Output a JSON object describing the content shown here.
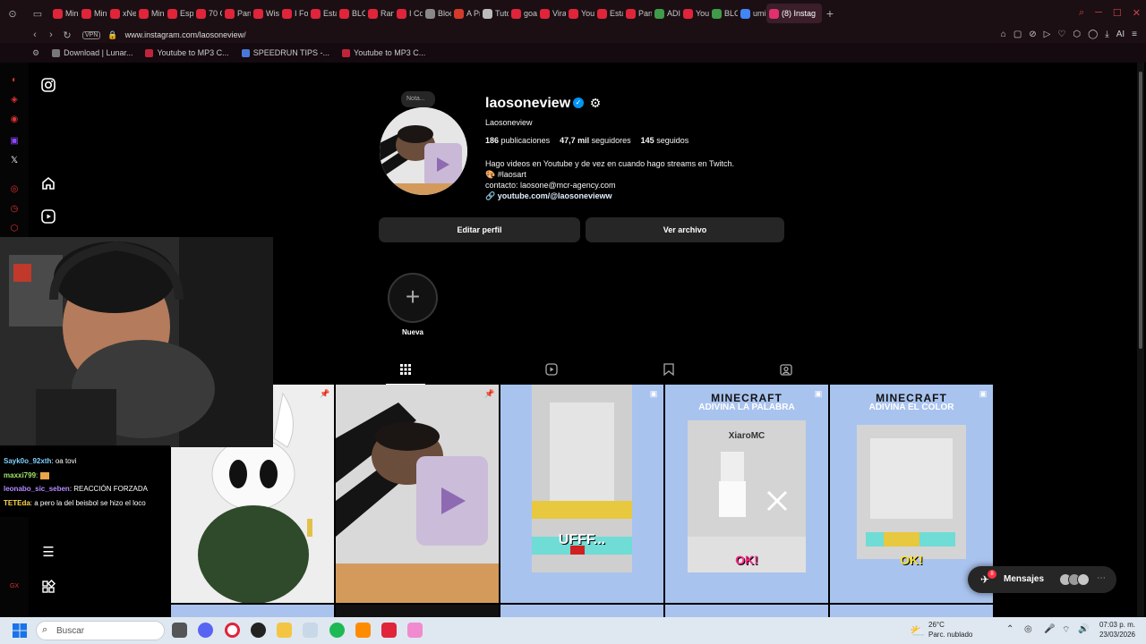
{
  "browser": {
    "tabs": [
      {
        "label": "Min",
        "color": "#e0243a"
      },
      {
        "label": "Min",
        "color": "#e0243a"
      },
      {
        "label": "xNe",
        "color": "#e0243a"
      },
      {
        "label": "Min",
        "color": "#e0243a"
      },
      {
        "label": "Esp",
        "color": "#e0243a"
      },
      {
        "label": "70 C",
        "color": "#e0243a"
      },
      {
        "label": "Pan",
        "color": "#e0243a"
      },
      {
        "label": "Wis",
        "color": "#e0243a"
      },
      {
        "label": "I Fo",
        "color": "#e0243a"
      },
      {
        "label": "Esta",
        "color": "#e0243a"
      },
      {
        "label": "BLC",
        "color": "#e0243a"
      },
      {
        "label": "Ran",
        "color": "#e0243a"
      },
      {
        "label": "I Co",
        "color": "#e0243a"
      },
      {
        "label": "Bloc",
        "color": "#888888"
      },
      {
        "label": "A Pr",
        "color": "#d43a2a"
      },
      {
        "label": "Tuto",
        "color": "#bbbbbb"
      },
      {
        "label": "goa",
        "color": "#e0243a"
      },
      {
        "label": "Vira",
        "color": "#e0243a"
      },
      {
        "label": "You",
        "color": "#e0243a"
      },
      {
        "label": "Esta",
        "color": "#e0243a"
      },
      {
        "label": "Pan",
        "color": "#e0243a"
      },
      {
        "label": "ADI",
        "color": "#3f9b48"
      },
      {
        "label": "You",
        "color": "#e0243a"
      },
      {
        "label": "BLC",
        "color": "#3f9b48"
      },
      {
        "label": "umi",
        "color": "#4285f4"
      }
    ],
    "active_tab": {
      "label": "(8) Instag",
      "color": "#e1306c"
    },
    "new_tab_symbol": "+",
    "vpn_label": "VPN",
    "url": "www.instagram.com/laosoneview/",
    "ai_label": "AI",
    "bookmarks": [
      {
        "label": "Download | Lunar...",
        "color": "#777777"
      },
      {
        "label": "Youtube to MP3 C...",
        "color": "#c0243a"
      },
      {
        "label": "SPEEDRUN TIPS -...",
        "color": "#4a78d8"
      },
      {
        "label": "Youtube to MP3 C...",
        "color": "#c0243a"
      }
    ]
  },
  "profile": {
    "note_label": "Nota...",
    "username": "laosoneview",
    "verified_glyph": "✓",
    "full_name": "Laosoneview",
    "stats": [
      {
        "value": "186",
        "label": "publicaciones"
      },
      {
        "value": "47,7 mil",
        "label": "seguidores"
      },
      {
        "value": "145",
        "label": "seguidos"
      }
    ],
    "bio_line1": "Hago videos en Youtube y de vez en cuando hago streams en Twitch.",
    "bio_line2": "#laosart",
    "bio_line3": "contacto: laosone@mcr-agency.com",
    "bio_link": "youtube.com/@laosonevieww",
    "edit_button": "Editar perfil",
    "archive_button": "Ver archivo",
    "highlight_label": "Nueva",
    "highlight_symbol": "+"
  },
  "grid_posts": [
    {
      "kind": "plush"
    },
    {
      "kind": "photo"
    },
    {
      "kind": "minecraft",
      "title": "",
      "subtitle": "",
      "overlay": "UFFF..."
    },
    {
      "kind": "minecraft",
      "title": "MINECRAFT",
      "subtitle": "ADIVINA LA PALABRA",
      "player": "XiaroMC",
      "overlay": "OK!"
    },
    {
      "kind": "minecraft",
      "title": "MINECRAFT",
      "subtitle": "ADIVINA EL COLOR",
      "overlay": "OK!"
    }
  ],
  "messages": {
    "label": "Mensajes",
    "count": "8"
  },
  "chat": [
    {
      "user": "Sayk0o_92xth",
      "text": ": oa tovi",
      "color": "#7fd1ff"
    },
    {
      "user": "maxxi799",
      "text": ":",
      "color": "#a0e26b"
    },
    {
      "user": "leonabo_sic_seben",
      "text": ": REACCIÓN FORZADA",
      "color": "#b58cff"
    },
    {
      "user": "TETEda",
      "text": ": a pero la del beisbol se hizo el loco",
      "color": "#ffd84a"
    }
  ],
  "taskbar": {
    "search_placeholder": "Buscar",
    "weather_temp": "26°C",
    "weather_desc": "Parc. nublado",
    "time": "07:03 p. m.",
    "date": "23/03/2026"
  },
  "colors": {
    "ig_bg": "#000000",
    "button_bg": "#262626",
    "verified_blue": "#0095f6",
    "opera_red": "#e0243a"
  }
}
